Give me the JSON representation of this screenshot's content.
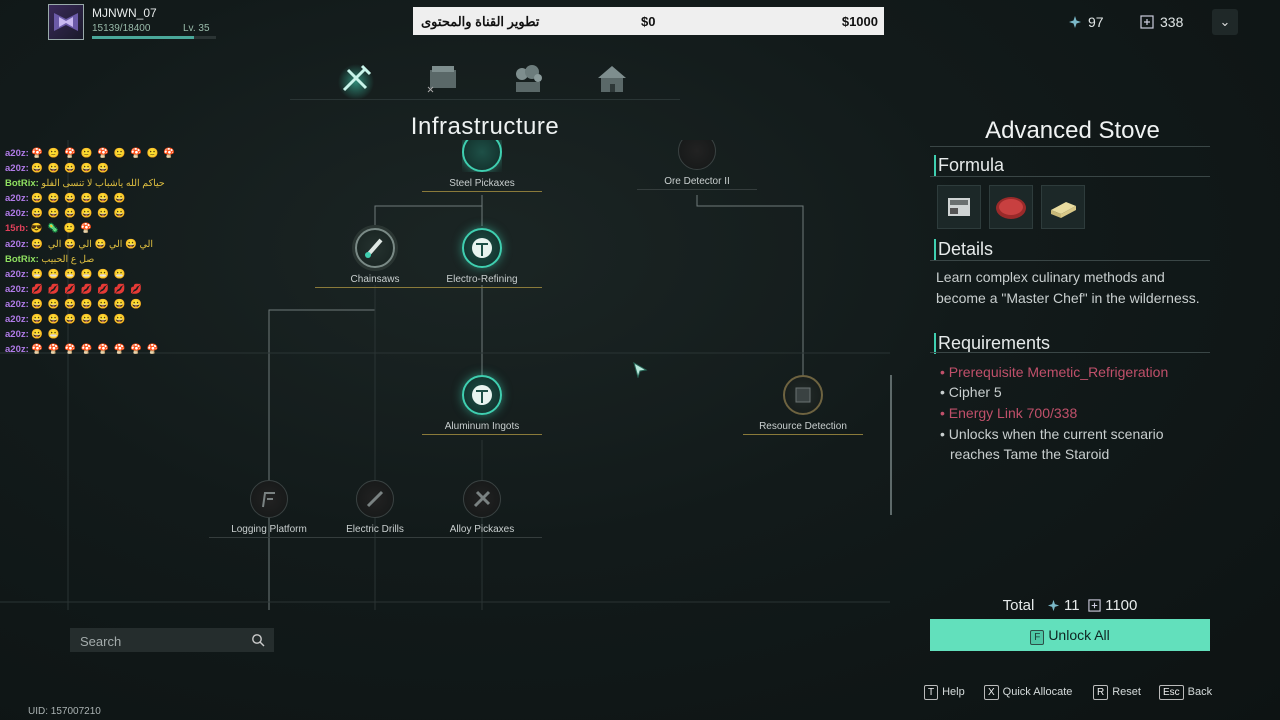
{
  "player": {
    "name": "MJNWN_07",
    "xp": "15139/18400",
    "xp_progress": 0.823,
    "level": "Lv. 35"
  },
  "donation": {
    "goal_text": "تطوير القناة والمحتوى",
    "current": "$0",
    "target": "$1000"
  },
  "currencies": [
    {
      "icon": "cipher-icon",
      "value": "97"
    },
    {
      "icon": "energy-link-icon",
      "value": "338"
    }
  ],
  "tabs": [
    {
      "icon": "pickaxe-icon",
      "active": true
    },
    {
      "icon": "workbench-icon"
    },
    {
      "icon": "plant-icon"
    },
    {
      "icon": "house-icon"
    }
  ],
  "section_title": "Infrastructure",
  "tree": {
    "nodes": [
      {
        "id": "steel",
        "label": "Steel Pickaxes",
        "state": "active",
        "icon": "pickaxe-icon"
      },
      {
        "id": "ore",
        "label": "Ore Detector II",
        "state": "locked",
        "icon": "detector-icon"
      },
      {
        "id": "chainsaws",
        "label": "Chainsaws",
        "state": "spiky",
        "icon": "chainsaw-icon"
      },
      {
        "id": "electro",
        "label": "Electro-Refining",
        "state": "active",
        "icon": "refining-icon"
      },
      {
        "id": "aluminum",
        "label": "Aluminum Ingots",
        "state": "active",
        "icon": "ingot-icon"
      },
      {
        "id": "resource",
        "label": "Resource Detection",
        "state": "gold",
        "icon": "resource-detection-icon"
      },
      {
        "id": "logging",
        "label": "Logging Platform",
        "state": "locked",
        "icon": "platform-icon"
      },
      {
        "id": "drills",
        "label": "Electric Drills",
        "state": "locked",
        "icon": "drill-icon"
      },
      {
        "id": "alloy",
        "label": "Alloy Pickaxes",
        "state": "locked",
        "icon": "alloy-pickaxe-icon"
      }
    ]
  },
  "chat": [
    {
      "user": "a20z:",
      "color": "#b07be8",
      "msg": "🍄 🙂 🍄 🙂 🍄 🙂 🍄 🙂 🍄"
    },
    {
      "user": "a20z:",
      "color": "#b07be8",
      "msg": "😀 😀 😀 😀 😀"
    },
    {
      "user": "BotRix:",
      "color": "#8fe060",
      "msg": "حياكم الله ياشباب لا تنسى الفلو"
    },
    {
      "user": "a20z:",
      "color": "#b07be8",
      "msg": "😀 😀 😀 😀 😀 😀"
    },
    {
      "user": "a20z:",
      "color": "#b07be8",
      "msg": "😀 😀 😀 😀 😀 😀"
    },
    {
      "user": "15rb:",
      "color": "#e0405a",
      "msg": "😎 🦠 🙂 🍄"
    },
    {
      "user": "a20z:",
      "color": "#b07be8",
      "msg": "😀 الي 😀 الي 😀 الي 😀 الي"
    },
    {
      "user": "BotRix:",
      "color": "#8fe060",
      "msg": "صل ع الحبيب"
    },
    {
      "user": "a20z:",
      "color": "#b07be8",
      "msg": "😬 😬 😬 😬 😬 😬"
    },
    {
      "user": "a20z:",
      "color": "#b07be8",
      "msg": "💋 💋 💋 💋 💋 💋 💋"
    },
    {
      "user": "a20z:",
      "color": "#b07be8",
      "msg": "😀 😀 😀 😀 😀 😀 😀"
    },
    {
      "user": "a20z:",
      "color": "#b07be8",
      "msg": "😀  😀  😀  😀  😀  😀"
    },
    {
      "user": "a20z:",
      "color": "#b07be8",
      "msg": "😀 😬"
    },
    {
      "user": "a20z:",
      "color": "#b07be8",
      "msg": "🍄 🍄 🍄 🍄 🍄 🍄 🍄 🍄"
    }
  ],
  "detail": {
    "title": "Advanced Stove",
    "formula_label": "Formula",
    "formula_items": [
      {
        "icon": "stove-icon"
      },
      {
        "icon": "meat-icon"
      },
      {
        "icon": "butter-icon"
      }
    ],
    "details_label": "Details",
    "details_text": "Learn complex culinary methods and become a \"Master Chef\" in the wilderness.",
    "requirements_label": "Requirements",
    "requirements": [
      {
        "text": "Prerequisite Memetic_Refrigeration",
        "unmet": true
      },
      {
        "text": "Cipher 5",
        "unmet": false
      },
      {
        "text": "Energy Link 700/338",
        "unmet": true
      },
      {
        "text": "Unlocks when the current scenario reaches Tame the Staroid",
        "unmet": false
      }
    ]
  },
  "total": {
    "label": "Total",
    "cipher": "11",
    "energy": "1100"
  },
  "unlock": {
    "key": "F",
    "label": "Unlock All"
  },
  "search": {
    "placeholder": "Search"
  },
  "hints": [
    {
      "key": "T",
      "label": "Help"
    },
    {
      "key": "X",
      "label": "Quick Allocate"
    },
    {
      "key": "R",
      "label": "Reset"
    },
    {
      "key": "Esc",
      "label": "Back"
    }
  ],
  "uid": "UID: 157007210",
  "colors": {
    "accent": "#62e0bc",
    "unmet": "#c0506a",
    "background": "#121a1a"
  }
}
